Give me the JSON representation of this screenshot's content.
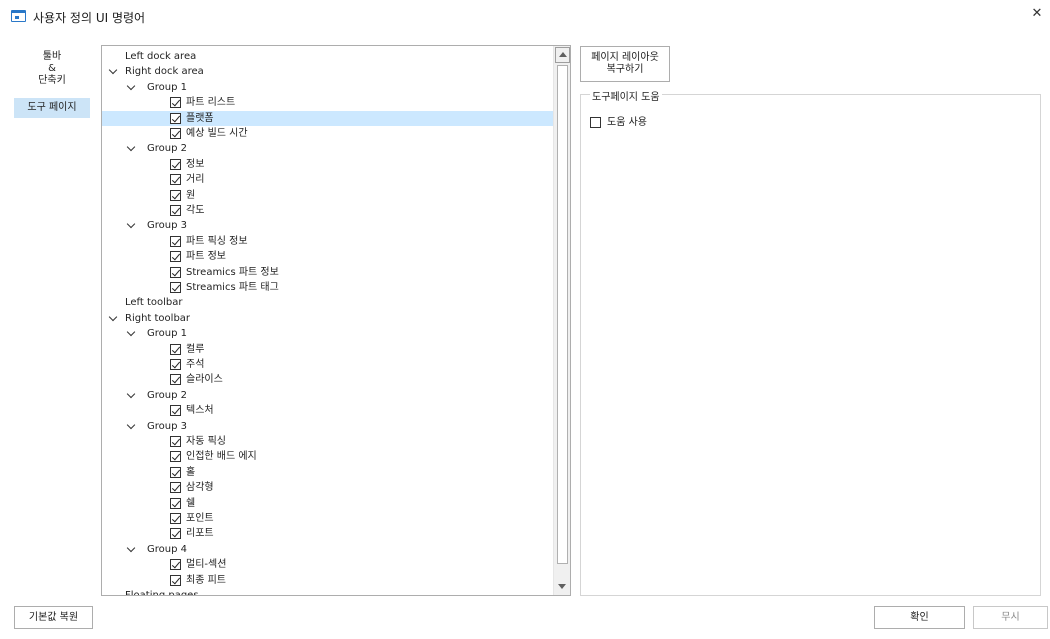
{
  "window": {
    "title": "사용자 정의 UI 명령어",
    "close_glyph": "✕",
    "app_icon": "window-icon"
  },
  "nav": {
    "items": [
      {
        "lines": [
          "툴바",
          "&",
          "단축키"
        ]
      },
      {
        "label": "도구 페이지",
        "selected": true
      }
    ]
  },
  "tree": {
    "rows": [
      {
        "label": "Left dock area",
        "depth": 0,
        "expandable": false,
        "checkbox": false
      },
      {
        "label": "Right dock area",
        "depth": 0,
        "expandable": true,
        "checkbox": false
      },
      {
        "label": "Group 1",
        "depth": 1,
        "expandable": true,
        "checkbox": false
      },
      {
        "label": "파트 리스트",
        "depth": 2,
        "checkbox": true,
        "checked": true
      },
      {
        "label": "플랫폼",
        "depth": 2,
        "checkbox": true,
        "checked": true,
        "selected": true
      },
      {
        "label": "예상 빌드 시간",
        "depth": 2,
        "checkbox": true,
        "checked": true
      },
      {
        "label": "Group 2",
        "depth": 1,
        "expandable": true,
        "checkbox": false
      },
      {
        "label": "정보",
        "depth": 2,
        "checkbox": true,
        "checked": true
      },
      {
        "label": "거리",
        "depth": 2,
        "checkbox": true,
        "checked": true
      },
      {
        "label": "원",
        "depth": 2,
        "checkbox": true,
        "checked": true
      },
      {
        "label": "각도",
        "depth": 2,
        "checkbox": true,
        "checked": true
      },
      {
        "label": "Group 3",
        "depth": 1,
        "expandable": true,
        "checkbox": false
      },
      {
        "label": "파트 픽싱 정보",
        "depth": 2,
        "checkbox": true,
        "checked": true
      },
      {
        "label": "파트 정보",
        "depth": 2,
        "checkbox": true,
        "checked": true
      },
      {
        "label": "Streamics 파트 정보",
        "depth": 2,
        "checkbox": true,
        "checked": true
      },
      {
        "label": "Streamics 파트 태그",
        "depth": 2,
        "checkbox": true,
        "checked": true
      },
      {
        "label": "Left toolbar",
        "depth": 0,
        "expandable": false,
        "checkbox": false
      },
      {
        "label": "Right toolbar",
        "depth": 0,
        "expandable": true,
        "checkbox": false
      },
      {
        "label": "Group 1",
        "depth": 1,
        "expandable": true,
        "checkbox": false
      },
      {
        "label": "컬루",
        "depth": 2,
        "checkbox": true,
        "checked": true
      },
      {
        "label": "주석",
        "depth": 2,
        "checkbox": true,
        "checked": true
      },
      {
        "label": "슬라이스",
        "depth": 2,
        "checkbox": true,
        "checked": true
      },
      {
        "label": "Group 2",
        "depth": 1,
        "expandable": true,
        "checkbox": false
      },
      {
        "label": "텍스처",
        "depth": 2,
        "checkbox": true,
        "checked": true
      },
      {
        "label": "Group 3",
        "depth": 1,
        "expandable": true,
        "checkbox": false
      },
      {
        "label": "자동 픽싱",
        "depth": 2,
        "checkbox": true,
        "checked": true
      },
      {
        "label": "인접한 배드 에지",
        "depth": 2,
        "checkbox": true,
        "checked": true
      },
      {
        "label": "홀",
        "depth": 2,
        "checkbox": true,
        "checked": true
      },
      {
        "label": "삼각형",
        "depth": 2,
        "checkbox": true,
        "checked": true
      },
      {
        "label": "쉘",
        "depth": 2,
        "checkbox": true,
        "checked": true
      },
      {
        "label": "포인트",
        "depth": 2,
        "checkbox": true,
        "checked": true
      },
      {
        "label": "리포트",
        "depth": 2,
        "checkbox": true,
        "checked": true
      },
      {
        "label": "Group 4",
        "depth": 1,
        "expandable": true,
        "checkbox": false
      },
      {
        "label": "멀티-섹션",
        "depth": 2,
        "checkbox": true,
        "checked": true
      },
      {
        "label": "최종 피트",
        "depth": 2,
        "checkbox": true,
        "checked": true
      },
      {
        "label": "Floating pages",
        "depth": 0,
        "expandable": false,
        "checkbox": false
      }
    ]
  },
  "right_panel": {
    "restore_layout_lines": [
      "페이지 레이아웃",
      "복구하기"
    ],
    "group_title": "도구페이지 도움",
    "help_checkbox_label": "도움 사용",
    "help_checked": false
  },
  "footer": {
    "restore_defaults": "기본값 복원",
    "ok": "확인",
    "cancel": "무시"
  }
}
